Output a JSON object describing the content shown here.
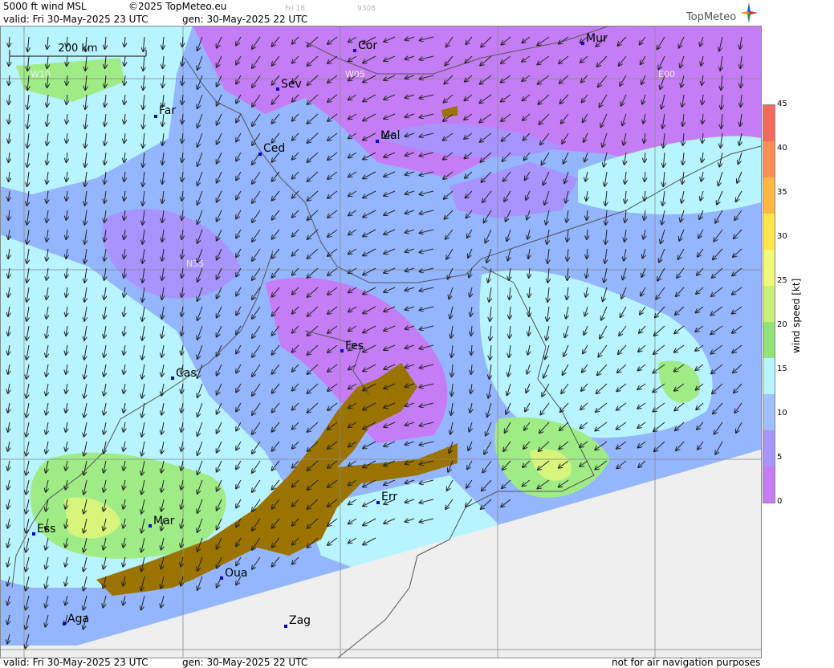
{
  "header": {
    "title": "5000 ft wind MSL",
    "copyright": "©2025 TopMeteo.eu",
    "valid": "valid:  Fri  30-May-2025  23 UTC",
    "gen": "gen: 30-May-2025 22 UTC",
    "faint_day": "Fri 18",
    "faint_code": "9308",
    "brand": "TopMeteo"
  },
  "footer": {
    "valid": "valid:  Fri  30-May-2025  23 UTC",
    "gen": "gen: 30-May-2025 22 UTC",
    "disclaimer": "not for air navigation purposes"
  },
  "map": {
    "scale_label": "200 km",
    "grid_labels": {
      "w10": "W10",
      "w05": "W05",
      "e00": "E00",
      "n35": "N35"
    },
    "cities": [
      {
        "name": "Cor"
      },
      {
        "name": "Mur"
      },
      {
        "name": "Sev"
      },
      {
        "name": "Far"
      },
      {
        "name": "Mal"
      },
      {
        "name": "Ced"
      },
      {
        "name": "Fes"
      },
      {
        "name": "Cas"
      },
      {
        "name": "Err"
      },
      {
        "name": "Ess"
      },
      {
        "name": "Mar"
      },
      {
        "name": "Oua"
      },
      {
        "name": "Aga"
      },
      {
        "name": "Zag"
      }
    ],
    "colors": {
      "violet": "#c57df5",
      "purple": "#a993ff",
      "blue": "#94b6ff",
      "cyan": "#b7f4ff",
      "lightgreen": "#9fec87",
      "green": "#74e05c",
      "yellowgreen": "#d7f57a",
      "terrain": "#9a7300",
      "nodata": "#efefef"
    }
  },
  "legend": {
    "title": "wind  speed  [kt]",
    "ticks": [
      "45",
      "40",
      "35",
      "30",
      "25",
      "20",
      "15",
      "10",
      "5",
      "0"
    ],
    "colors": [
      "#f46b5d",
      "#ff8f55",
      "#ffb845",
      "#ffe64a",
      "#f2f97a",
      "#c8f07a",
      "#8fe37a",
      "#b5f3ff",
      "#9fc0ff",
      "#a993ff",
      "#c57df5"
    ]
  }
}
